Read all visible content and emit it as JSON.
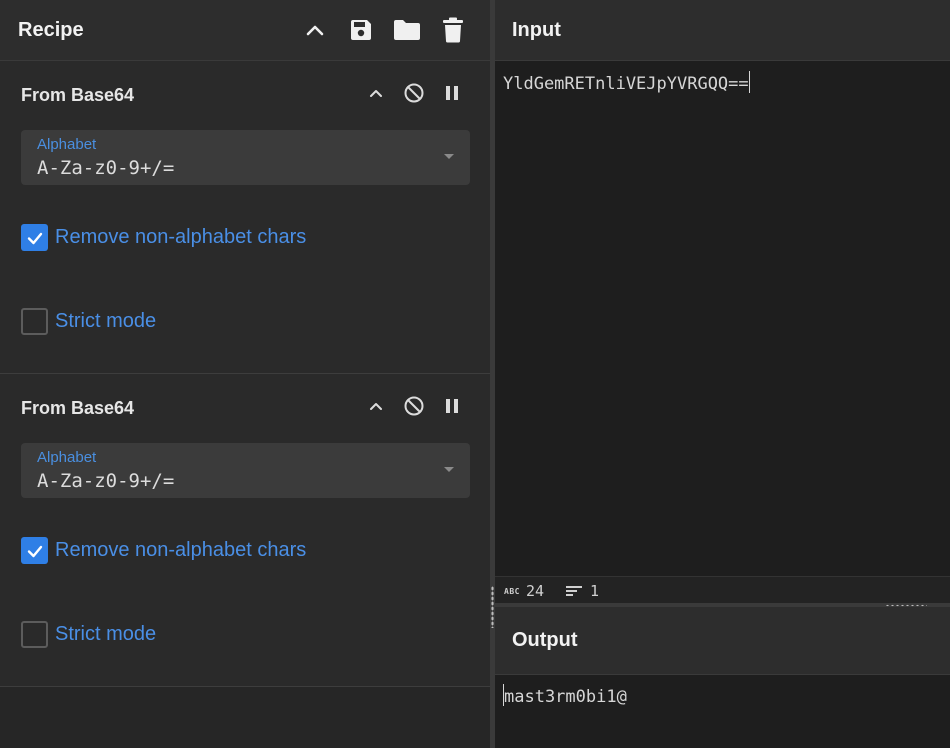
{
  "recipe": {
    "title": "Recipe",
    "header_icons": [
      "chevron-up-icon",
      "save-icon",
      "folder-icon",
      "trash-icon"
    ],
    "operations": [
      {
        "title": "From Base64",
        "alphabet_label": "Alphabet",
        "alphabet_value": "A-Za-z0-9+/=",
        "remove_non_alphabet": {
          "label": "Remove non-alphabet chars",
          "checked": true
        },
        "strict_mode": {
          "label": "Strict mode",
          "checked": false
        }
      },
      {
        "title": "From Base64",
        "alphabet_label": "Alphabet",
        "alphabet_value": "A-Za-z0-9+/=",
        "remove_non_alphabet": {
          "label": "Remove non-alphabet chars",
          "checked": true
        },
        "strict_mode": {
          "label": "Strict mode",
          "checked": false
        }
      }
    ]
  },
  "input": {
    "title": "Input",
    "text": "YldGemRETnliVEJpYVRGQQ==",
    "stats": {
      "length": "24",
      "lines": "1"
    }
  },
  "output": {
    "title": "Output",
    "text": "mast3rm0bi1@"
  },
  "colors": {
    "accent": "#2f7fe6",
    "label_blue": "#4a8fe6",
    "background": "#1e1e1e",
    "panel": "#2a2a2a"
  }
}
